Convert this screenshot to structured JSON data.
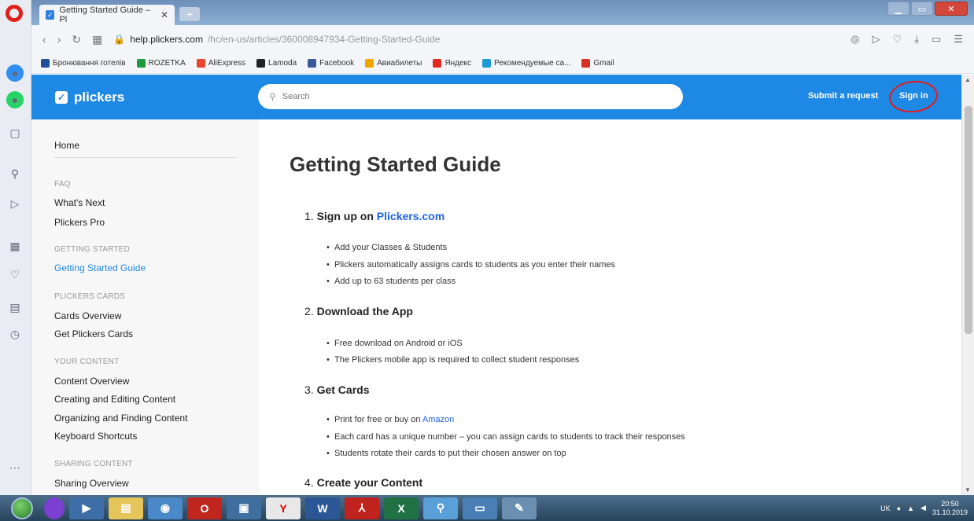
{
  "browser": {
    "tab_title": "Getting Started Guide – Pl",
    "tab_close": "✕",
    "new_tab": "+",
    "url_domain": "help.plickers.com",
    "url_path": "/hc/en-us/articles/360008947934-Getting-Started-Guide",
    "bookmarks": [
      {
        "label": "Бронювання готелів",
        "color": "#1f4e9b"
      },
      {
        "label": "ROZETKA",
        "color": "#1e9a3c"
      },
      {
        "label": "AliExpress",
        "color": "#e8462b"
      },
      {
        "label": "Lamoda",
        "color": "#222222"
      },
      {
        "label": "Facebook",
        "color": "#3b5998"
      },
      {
        "label": "Авиабилеты",
        "color": "#f0a500"
      },
      {
        "label": "Яндекс",
        "color": "#e52620"
      },
      {
        "label": "Рекомендуемые са...",
        "color": "#1b9bd1"
      },
      {
        "label": "Gmail",
        "color": "#d93025"
      }
    ]
  },
  "site": {
    "logo": "plickers",
    "search_placeholder": "Search",
    "submit_request": "Submit a request",
    "sign_in": "Sign in",
    "brand_color": "#1e88e5"
  },
  "sidebar": {
    "home": "Home",
    "sections": [
      {
        "title": "FAQ",
        "items": [
          "What's Next",
          "Plickers Pro"
        ]
      },
      {
        "title": "GETTING STARTED",
        "items": [
          "Getting Started Guide"
        ]
      },
      {
        "title": "PLICKERS CARDS",
        "items": [
          "Cards Overview",
          "Get Plickers Cards"
        ]
      },
      {
        "title": "YOUR CONTENT",
        "items": [
          "Content Overview",
          "Creating and Editing Content",
          "Organizing and Finding Content",
          "Keyboard Shortcuts"
        ]
      },
      {
        "title": "SHARING CONTENT",
        "items": [
          "Sharing Overview"
        ]
      }
    ]
  },
  "article": {
    "title": "Getting Started Guide",
    "steps": [
      {
        "num": "1.",
        "text": "Sign up on",
        "link": "Plickers.com",
        "bullets": [
          "Add your Classes & Students",
          "Plickers automatically assigns cards to students as you enter their names",
          "Add up to 63 students per class"
        ]
      },
      {
        "num": "2.",
        "text": "Download the App",
        "bullets": [
          "Free download on Android or iOS",
          "The Plickers mobile app is required to collect student responses"
        ]
      },
      {
        "num": "3.",
        "text": "Get Cards",
        "bullets_prefix": "Print for free or buy on",
        "bullets_link": "Amazon",
        "bullets": [
          "Each card has a unique number – you can assign cards to students to track their responses",
          "Students rotate their cards to put their chosen answer on top"
        ]
      },
      {
        "num": "4.",
        "text": "Create your Content"
      }
    ]
  },
  "taskbar": {
    "lang": "UK",
    "time": "20:50",
    "date": "31.10.2019"
  }
}
